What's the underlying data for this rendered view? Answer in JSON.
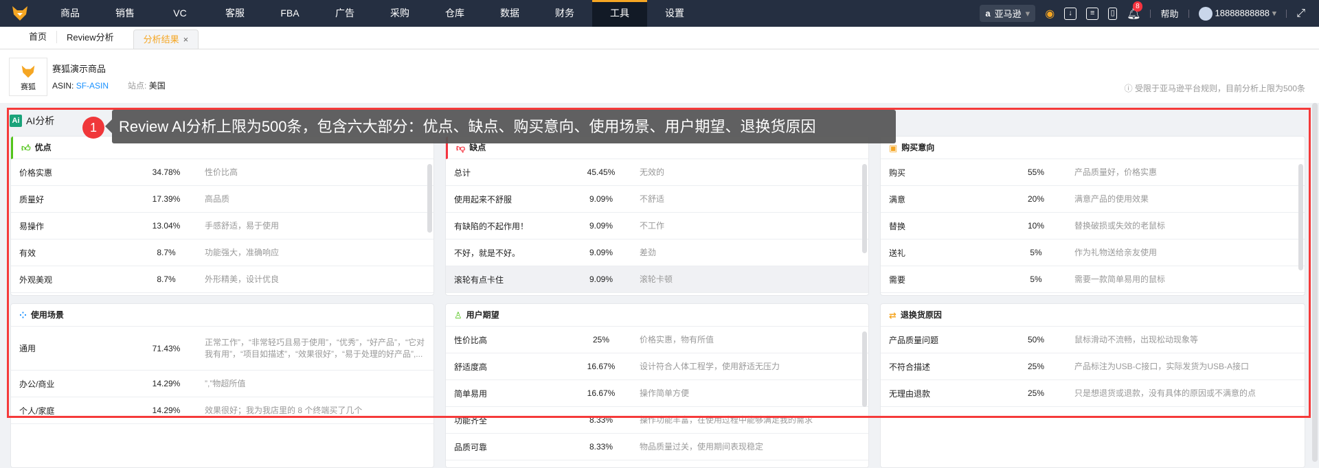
{
  "nav": {
    "menu": [
      "商品",
      "销售",
      "VC",
      "客服",
      "FBA",
      "广告",
      "采购",
      "仓库",
      "数据",
      "财务",
      "工具",
      "设置"
    ],
    "active": "工具",
    "marketplace": "亚马逊",
    "notification_count": "8",
    "help": "帮助",
    "user": "18888888888",
    "accent": "#f5a623"
  },
  "tabs": {
    "items": [
      "首页",
      "Review分析",
      "分析结果"
    ],
    "close": "×"
  },
  "product": {
    "logo_text": "赛狐",
    "name": "赛狐演示商品",
    "asin_label": "ASIN:",
    "asin": "SF-ASIN",
    "site_label": "站点:",
    "site": "美国",
    "limit_note": "受限于亚马逊平台规则，目前分析上限为500条"
  },
  "section": {
    "icon_text": "Ai",
    "title": "AI分析"
  },
  "annotation": {
    "number": "1",
    "text": "Review AI分析上限为500条，包含六大部分：优点、缺点、购买意向、使用场景、用户期望、退换货原因"
  },
  "cards": [
    {
      "title": "优点",
      "icon": "thumbs-up-icon",
      "rows": [
        [
          "价格实惠",
          "34.78%",
          "性价比高"
        ],
        [
          "质量好",
          "17.39%",
          "高品质"
        ],
        [
          "易操作",
          "13.04%",
          "手感舒适，易于使用"
        ],
        [
          "有效",
          "8.7%",
          "功能强大，准确响应"
        ],
        [
          "外观美观",
          "8.7%",
          "外形精美，设计优良"
        ]
      ]
    },
    {
      "title": "缺点",
      "icon": "thumbs-down-icon",
      "rows": [
        [
          "总计",
          "45.45%",
          "无效的"
        ],
        [
          "使用起来不舒服",
          "9.09%",
          "不舒适"
        ],
        [
          "有缺陷的不起作用！",
          "9.09%",
          "不工作"
        ],
        [
          "不好，就是不好。",
          "9.09%",
          "差劲"
        ],
        [
          "滚轮有点卡住",
          "9.09%",
          "滚轮卡顿"
        ]
      ]
    },
    {
      "title": "购买意向",
      "icon": "shopping-bag-icon",
      "rows": [
        [
          "购买",
          "55%",
          "产品质量好，价格实惠"
        ],
        [
          "满意",
          "20%",
          "满意产品的使用效果"
        ],
        [
          "替换",
          "10%",
          "替换破损或失效的老鼠标"
        ],
        [
          "送礼",
          "5%",
          "作为礼物送给亲友使用"
        ],
        [
          "需要",
          "5%",
          "需要一款简单易用的鼠标"
        ]
      ]
    },
    {
      "title": "使用场景",
      "icon": "grid-icon",
      "rows": [
        [
          "通用",
          "71.43%",
          "正常工作”，“非常轻巧且易于使用”，“优秀”，“好产品”，“它对我有用”，“项目如描述”，“效果很好”，“易于处理的好产品”,..."
        ],
        [
          "办公/商业",
          "14.29%",
          "”,”物超所值"
        ],
        [
          "个人/家庭",
          "14.29%",
          "效果很好；我为我店里的 8 个终端买了几个"
        ]
      ]
    },
    {
      "title": "用户期望",
      "icon": "user-icon",
      "rows": [
        [
          "性价比高",
          "25%",
          "价格实惠，物有所值"
        ],
        [
          "舒适度高",
          "16.67%",
          "设计符合人体工程学，使用舒适无压力"
        ],
        [
          "简单易用",
          "16.67%",
          "操作简单方便"
        ],
        [
          "功能齐全",
          "8.33%",
          "操作功能丰富，在使用过程中能够满足我的需求"
        ],
        [
          "品质可靠",
          "8.33%",
          "物品质量过关，使用期间表现稳定"
        ]
      ]
    },
    {
      "title": "退换货原因",
      "icon": "return-icon",
      "rows": [
        [
          "产品质量问题",
          "50%",
          "鼠标滑动不流畅，出现松动现象等"
        ],
        [
          "不符合描述",
          "25%",
          "产品标注为USB-C接口，实际发货为USB-A接口"
        ],
        [
          "无理由退款",
          "25%",
          "只是想退货或退款，没有具体的原因或不满意的点"
        ]
      ]
    }
  ]
}
